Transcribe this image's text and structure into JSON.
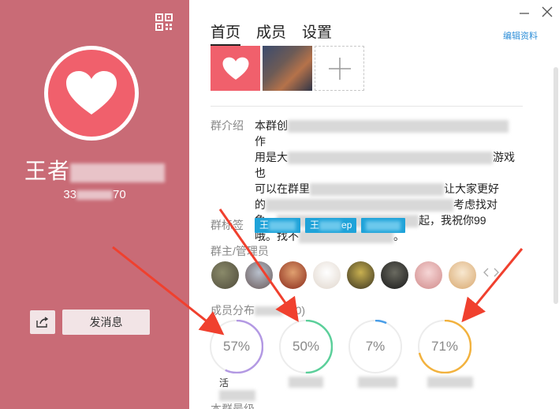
{
  "left": {
    "group_name": "王者",
    "group_id": "33",
    "group_id_tail": "70",
    "message_button": "发消息"
  },
  "tabs": [
    {
      "label": "首页",
      "active": true
    },
    {
      "label": "成员",
      "active": false
    },
    {
      "label": "设置",
      "active": false
    }
  ],
  "edit_profile": "编辑资料",
  "intro": {
    "label": "群介绍",
    "line1_start": "本群创",
    "line1_end": "作",
    "line2_start": "用是大",
    "line2_end": "游戏也",
    "line3_start": "可以在群里",
    "line3_end": "让大家更好",
    "line4_start": "的",
    "line4_end": "考虑找对",
    "line5_start": "象。",
    "line5_end": "起，我祝你99",
    "line6_start": "哦。找不",
    "line6_end": "。"
  },
  "tags": {
    "label": "群标签",
    "items": [
      "王",
      "王",
      "ep",
      ""
    ]
  },
  "admins": {
    "label": "群主/管理员",
    "count": 8
  },
  "distribution": {
    "label": "成员分布",
    "label_tail": "000)",
    "rings": [
      {
        "value": "57%",
        "fraction": 0.57,
        "color": "#b399e3",
        "caption": "活"
      },
      {
        "value": "50%",
        "fraction": 0.5,
        "color": "#5bcf9a",
        "caption": ""
      },
      {
        "value": "7%",
        "fraction": 0.07,
        "color": "#4a9ee8",
        "caption": ""
      },
      {
        "value": "71%",
        "fraction": 0.71,
        "color": "#f2b23e",
        "caption": ""
      }
    ]
  },
  "bottom_label": "本群最级",
  "colors": {
    "left_bg": "#c96b76",
    "accent": "#f0606c",
    "tag": "#1fa3d9",
    "link": "#2f8fd8",
    "arrow": "#f0402e"
  }
}
